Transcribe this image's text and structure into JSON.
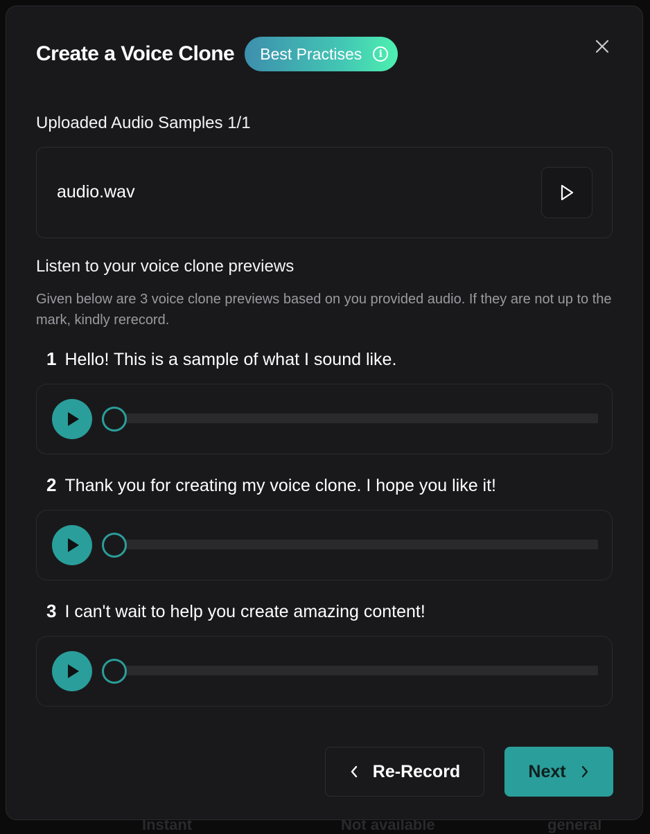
{
  "background_peek": [
    "Instant",
    "Not available",
    "general"
  ],
  "modal": {
    "title": "Create a Voice Clone",
    "best_practises_label": "Best Practises",
    "info_glyph": "i",
    "uploaded_label": "Uploaded Audio Samples 1/1",
    "file": {
      "name": "audio.wav"
    },
    "previews_heading": "Listen to your voice clone previews",
    "previews_description": "Given below are 3 voice clone previews based on you provided audio. If they are not up to the mark, kindly rerecord.",
    "samples": [
      {
        "number": "1",
        "text": "Hello! This is a sample of what I sound like.",
        "progress": 0
      },
      {
        "number": "2",
        "text": "Thank you for creating my voice clone. I hope you like it!",
        "progress": 0
      },
      {
        "number": "3",
        "text": "I can't wait to help you create amazing content!",
        "progress": 0
      }
    ],
    "rerecord_label": "Re-Record",
    "next_label": "Next"
  },
  "colors": {
    "accent": "#2a9e9a",
    "modal_bg": "#19191b",
    "gradient_start": "#3d8fad",
    "gradient_end": "#4df0b0"
  },
  "icons": {
    "close": "close-icon",
    "info": "info-icon",
    "play": "play-icon",
    "chevron_left": "chevron-left-icon",
    "chevron_right": "chevron-right-icon"
  }
}
